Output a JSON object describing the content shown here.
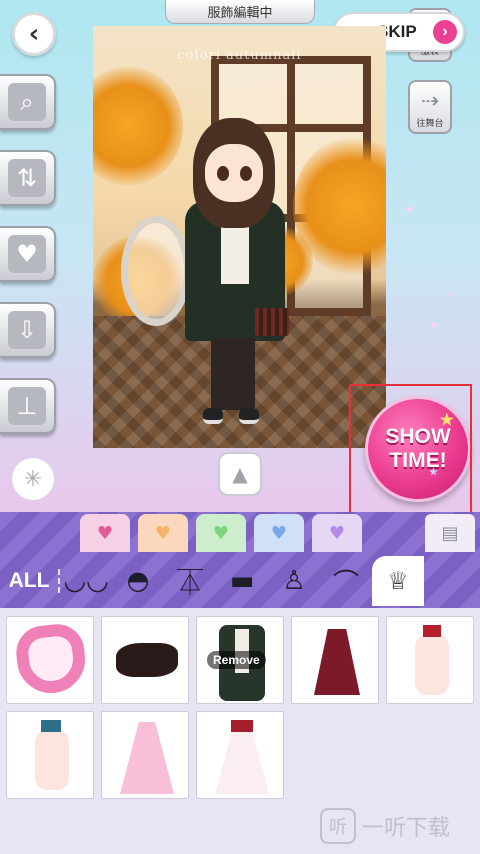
{
  "header": {
    "title": "服飾編輯中",
    "back_icon": "chevron-left-icon",
    "skip_label": "SKIP",
    "skip_arrow": "›"
  },
  "right_panel": {
    "wardrobe_label": "服裝",
    "stage_label": "往舞台"
  },
  "sidebar": {
    "items": [
      {
        "name": "zoom",
        "icon": "search-icon",
        "glyph": "⌕"
      },
      {
        "name": "sort",
        "icon": "swap-vertical-icon",
        "glyph": "⇅"
      },
      {
        "name": "favorite",
        "icon": "heart-plus-icon",
        "glyph": "♥"
      },
      {
        "name": "download-outfit",
        "icon": "download-shirt-icon",
        "glyph": "⇩"
      },
      {
        "name": "add-stand",
        "icon": "stand-plus-icon",
        "glyph": "⊥"
      }
    ],
    "loading_glyph": "✳"
  },
  "photo": {
    "caption": "colori autumnali"
  },
  "expand_glyph": "▲",
  "showtime": {
    "line1": "SHOW",
    "line2": "TIME!"
  },
  "tabs": {
    "colors": [
      "#f6d0e4",
      "#fbd8bd",
      "#cdeecd",
      "#cfe0f7",
      "#e6d8f5"
    ],
    "heart_glyph": "♥"
  },
  "categories": {
    "all_label": "ALL",
    "items": [
      "face-icon",
      "hair-icon",
      "top-icon",
      "bottom-icon",
      "pose-icon",
      "shoes-icon",
      "accessory-icon"
    ]
  },
  "items": {
    "remove_label": "Remove"
  },
  "watermark": {
    "logo_glyph": "听",
    "text": "一听下载"
  },
  "colors": {
    "accent": "#e9418f",
    "tab_purple": "#8b71d0",
    "highlight": "#e8303a"
  }
}
